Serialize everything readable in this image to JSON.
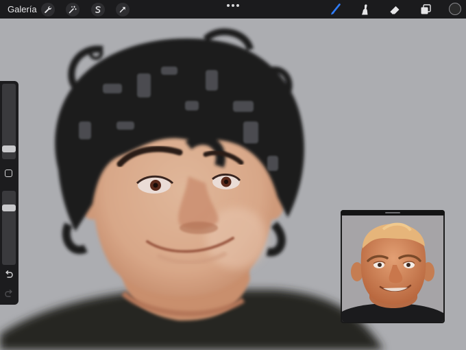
{
  "toolbar": {
    "gallery_label": "Galería",
    "left_tools": [
      "wrench-icon",
      "magic-wand-icon",
      "selection-s-icon",
      "arrow-transform-icon"
    ],
    "right_tools": [
      "brush-icon",
      "smudge-icon",
      "eraser-icon",
      "layers-icon"
    ],
    "brush_active_color": "#2f7bf5",
    "current_color": "#2b2b2b"
  },
  "sidebar": {
    "brush_size_level": 0.1,
    "opacity_level": 0.8,
    "icons": [
      "modify-square-icon",
      "undo-icon",
      "redo-icon"
    ]
  },
  "canvas": {
    "background_color": "#acadb1"
  },
  "reference_window": {
    "background_color": "#a6a4a7"
  }
}
